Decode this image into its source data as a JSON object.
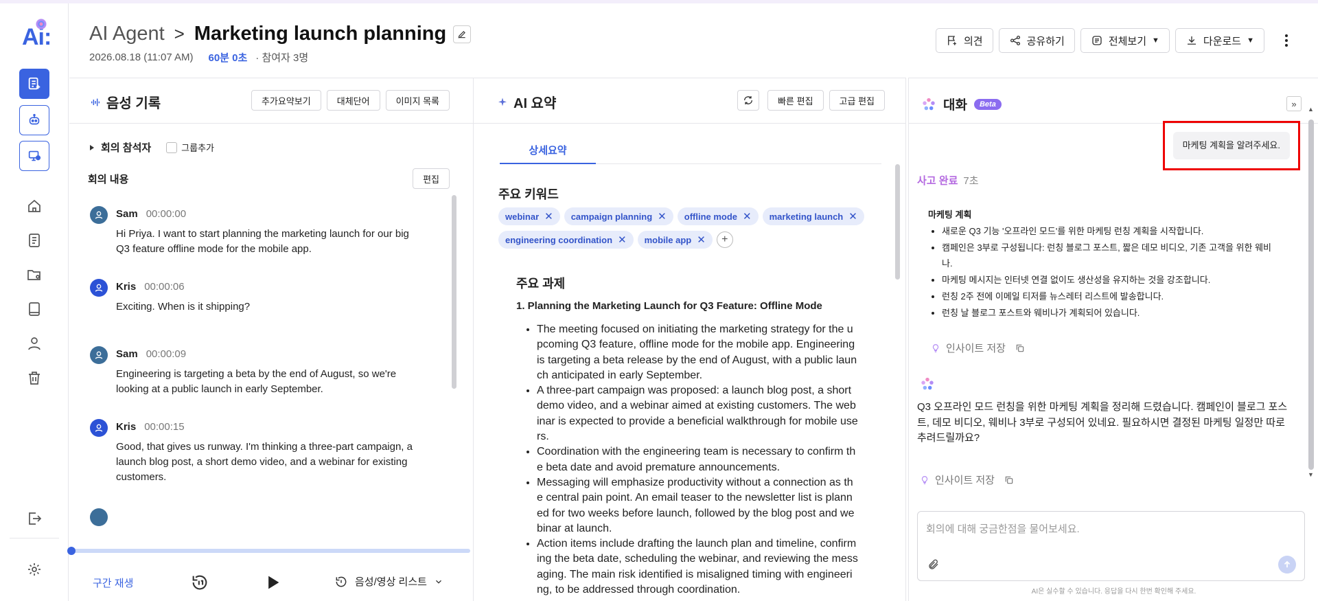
{
  "brand": {
    "logo_text": "Ai:",
    "accent": "#3a63e0"
  },
  "header": {
    "breadcrumb_root": "AI Agent",
    "breadcrumb_sep": ">",
    "title": "Marketing launch planning",
    "date": "2026.08.18 (11:07 AM)",
    "duration": "60분 0초",
    "participants": "· 참여자 3명",
    "buttons": {
      "feedback": "의견",
      "share": "공유하기",
      "view_all": "전체보기",
      "download": "다운로드"
    }
  },
  "transcript_panel": {
    "title": "음성 기록",
    "tools": {
      "more_summary": "추가요약보기",
      "replace_word": "대체단어",
      "image_list": "이미지 목록"
    },
    "attendees_label": "회의 참석자",
    "group_add": "그룹추가",
    "minutes_label": "회의 내용",
    "edit": "편집",
    "entries": [
      {
        "speaker": "Sam",
        "time": "00:00:00",
        "text": "Hi Priya. I want to start planning the marketing launch for our big Q3 feature offline mode for the mobile app."
      },
      {
        "speaker": "Kris",
        "time": "00:00:06",
        "text": "Exciting. When is it shipping?"
      },
      {
        "speaker": "Sam",
        "time": "00:00:09",
        "text": "Engineering is targeting a beta by the end of August, so we're looking at a public launch in early September."
      },
      {
        "speaker": "Kris",
        "time": "00:00:15",
        "text": "Good, that gives us runway.  I'm thinking a three-part campaign, a launch blog post, a short demo video, and a webinar  for existing customers."
      }
    ],
    "section_play": "구간 재생",
    "media_list": "음성/영상 리스트"
  },
  "summary_panel": {
    "title": "AI 요약",
    "tools": {
      "quick_edit": "빠른 편집",
      "advanced_edit": "고급 편집"
    },
    "tab": "상세요약",
    "keywords_title": "주요 키워드",
    "keywords": [
      "webinar",
      "campaign planning",
      "offline mode",
      "marketing launch",
      "engineering coordination",
      "mobile app"
    ],
    "chip_remove": "✕",
    "add_symbol": "+",
    "tasks_title": "주요 과제",
    "task_subtitle": "1. Planning the Marketing Launch for Q3 Feature: Offline Mode",
    "bullets": [
      "The meeting focused on initiating the marketing strategy for the upcoming Q3 feature, offline mode for the mobile app. Engineering is targeting a beta release by the end of August, with a public launch anticipated in early September.",
      "A three-part campaign was proposed: a launch blog post, a short demo video, and a webinar aimed at existing customers. The webinar is expected to provide a beneficial walkthrough for mobile users.",
      "Coordination with the engineering team is necessary to confirm the beta date and avoid premature announcements.",
      "Messaging will emphasize productivity without a connection as the central pain point. An email teaser to the newsletter list is planned for two weeks before launch, followed by the blog post and webinar at launch.",
      "Action items include drafting the launch plan and timeline, confirming the beta date, scheduling the webinar, and reviewing the messaging. The main risk identified is misaligned timing with engineering, to be addressed through coordination."
    ]
  },
  "chat_panel": {
    "title": "대화",
    "beta": "Beta",
    "collapse": "»",
    "user_message": "마케팅 계획을 알려주세요.",
    "thinking_done": "사고 완료",
    "thinking_secs": "7초",
    "plan_title": "마케팅 계획",
    "plan_items": [
      "새로운 Q3 기능 '오프라인 모드'를 위한 마케팅 런칭 계획을 시작합니다.",
      "캠페인은 3부로 구성됩니다: 런칭 블로그 포스트, 짧은 데모 비디오, 기존 고객을 위한 웨비나.",
      "마케팅 메시지는 인터넷 연결 없이도 생산성을 유지하는 것을 강조합니다.",
      "런칭 2주 전에 이메일 티저를 뉴스레터 리스트에 발송합니다.",
      "런칭 날 블로그 포스트와 웨비나가 계획되어 있습니다."
    ],
    "save_insight": "인사이트 저장",
    "ai_reply": "Q3 오프라인 모드 런칭을 위한 마케팅 계획을 정리해 드렸습니다. 캠페인이 블로그 포스트, 데모 비디오, 웨비나 3부로 구성되어 있네요. 필요하시면 결정된 마케팅 일정만 따로 추려드릴까요?",
    "input_placeholder": "회의에 대해 궁금한점을 물어보세요.",
    "disclaimer": "AI은 실수할 수 있습니다. 응답을 다시 한번 확인해 주세요."
  }
}
